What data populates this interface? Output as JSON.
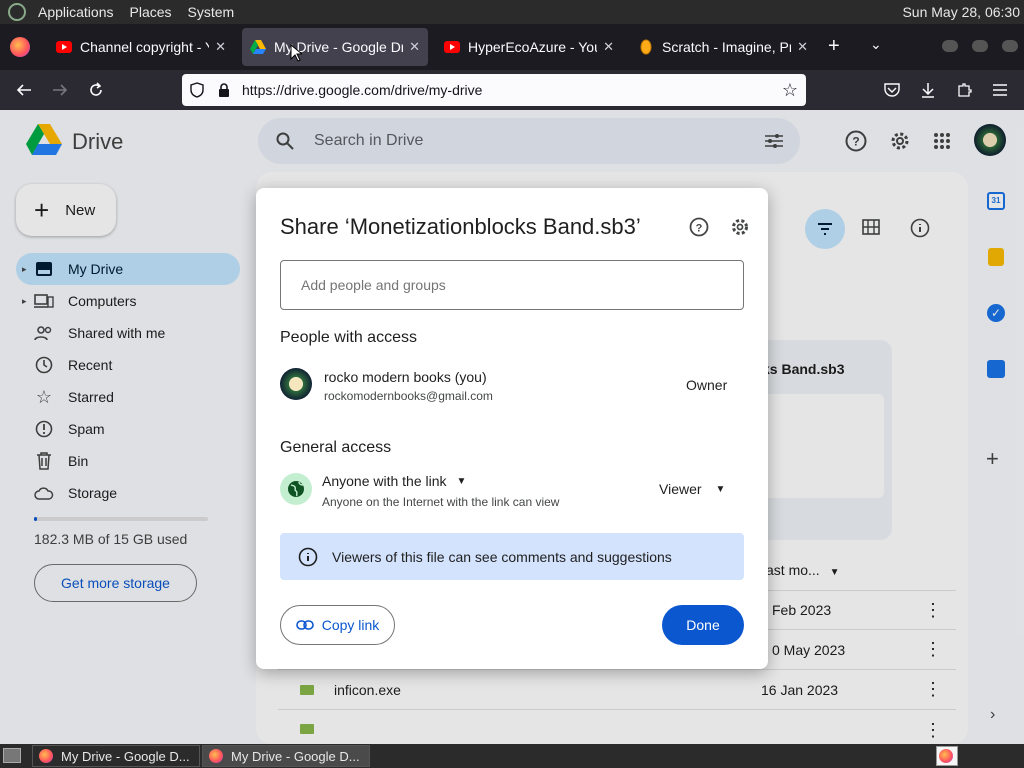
{
  "system_panel": {
    "menus": [
      "Applications",
      "Places",
      "System"
    ],
    "clock": "Sun May 28, 06:30"
  },
  "browser": {
    "tabs": [
      {
        "title": "Channel copyright - Yo",
        "icon": "youtube-icon",
        "active": false
      },
      {
        "title": "My Drive - Google Dri",
        "icon": "google-drive-icon",
        "active": true
      },
      {
        "title": "HyperEcoAzure - YouT",
        "icon": "youtube-icon",
        "active": false
      },
      {
        "title": "Scratch - Imagine, Prog",
        "icon": "scratch-icon",
        "active": false
      }
    ],
    "url": "https://drive.google.com/drive/my-drive"
  },
  "drive": {
    "logo_text": "Drive",
    "search_placeholder": "Search in Drive",
    "new_label": "New",
    "sidebar": [
      {
        "label": "My Drive",
        "icon": "my-drive-icon",
        "selected": true
      },
      {
        "label": "Computers",
        "icon": "computers-icon",
        "selected": false
      },
      {
        "label": "Shared with me",
        "icon": "shared-icon",
        "selected": false
      },
      {
        "label": "Recent",
        "icon": "clock-icon",
        "selected": false
      },
      {
        "label": "Starred",
        "icon": "star-icon",
        "selected": false
      },
      {
        "label": "Spam",
        "icon": "spam-icon",
        "selected": false
      },
      {
        "label": "Bin",
        "icon": "bin-icon",
        "selected": false
      },
      {
        "label": "Storage",
        "icon": "cloud-icon",
        "selected": false
      }
    ],
    "storage_used_fraction": 0.012,
    "storage_text": "182.3 MB of 15 GB used",
    "get_storage_label": "Get more storage",
    "card_title_partial": "ks Band.sb3",
    "column_last_modified": "ast mo...",
    "files": [
      {
        "name": "",
        "date": "Feb 2023"
      },
      {
        "name": "",
        "date": "0 May 2023"
      },
      {
        "name": "inficon.exe",
        "date": "16 Jan 2023"
      },
      {
        "name": "",
        "date": ""
      }
    ]
  },
  "share_dialog": {
    "title": "Share ‘Monetizationblocks Band.sb3’",
    "add_placeholder": "Add people and groups",
    "people_heading": "People with access",
    "owner_name": "rocko modern books (you)",
    "owner_email": "rockomodernbooks@gmail.com",
    "owner_role": "Owner",
    "general_heading": "General access",
    "access_type": "Anyone with the link",
    "access_desc": "Anyone on the Internet with the link can view",
    "access_role": "Viewer",
    "info_text": "Viewers of this file can see comments and suggestions",
    "copy_link_label": "Copy link",
    "done_label": "Done"
  },
  "taskbar": {
    "tasks": [
      {
        "title": "My Drive - Google D...",
        "active": false
      },
      {
        "title": "My Drive - Google D...",
        "active": true
      }
    ]
  },
  "colors": {
    "accent": "#0b57d0",
    "selected_bg": "#c2e7ff",
    "info_bg": "#d3e3fd"
  }
}
